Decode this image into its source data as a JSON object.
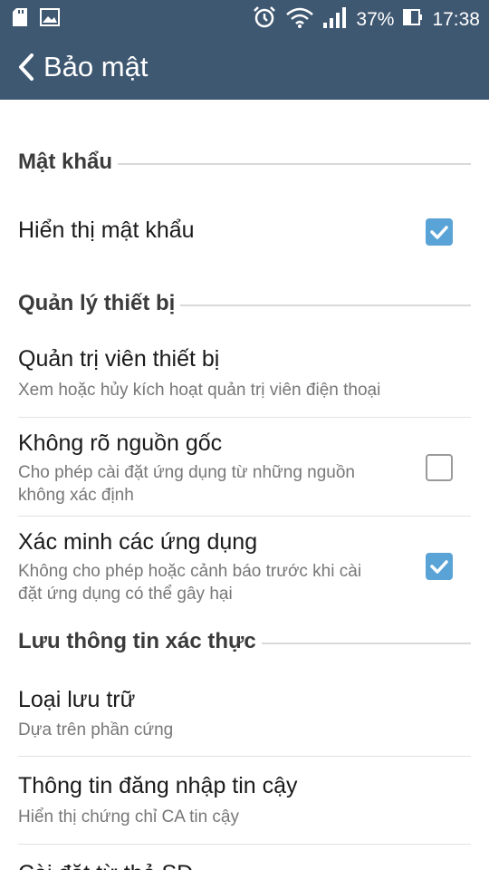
{
  "status_bar": {
    "battery": "37%",
    "time": "17:38"
  },
  "app_bar": {
    "title": "Bảo mật"
  },
  "sections": {
    "password": "Mật khẩu",
    "device_admin": "Quản lý thiết bị",
    "credential_storage": "Lưu thông tin xác thực"
  },
  "settings": {
    "show_password": {
      "title": "Hiển thị mật khẩu",
      "checked": true
    },
    "device_administrators": {
      "title": "Quản trị viên thiết bị",
      "summary": "Xem hoặc hủy kích hoạt quản trị viên điện thoại"
    },
    "unknown_sources": {
      "title": "Không rõ nguồn gốc",
      "summary": "Cho phép cài đặt ứng dụng từ những nguồn không xác định",
      "checked": false
    },
    "verify_apps": {
      "title": "Xác minh các ứng dụng",
      "summary": "Không cho phép hoặc cảnh báo trước khi cài đặt ứng dụng có thể gây hại",
      "checked": true
    },
    "storage_type": {
      "title": "Loại lưu trữ",
      "summary": "Dựa trên phần cứng"
    },
    "trusted_credentials": {
      "title": "Thông tin đăng nhập tin cậy",
      "summary": "Hiển thị chứng chỉ CA tin cậy"
    },
    "install_from_sd": {
      "title": "Cài đặt từ thẻ SD"
    }
  },
  "colors": {
    "bar": "#3f5872",
    "checkbox_on": "#5aa3d6"
  },
  "icons": [
    "sd-card-icon",
    "image-icon",
    "alarm-icon",
    "wifi-icon",
    "signal-icon",
    "battery-icon",
    "back-chevron-icon",
    "checkmark-icon"
  ]
}
